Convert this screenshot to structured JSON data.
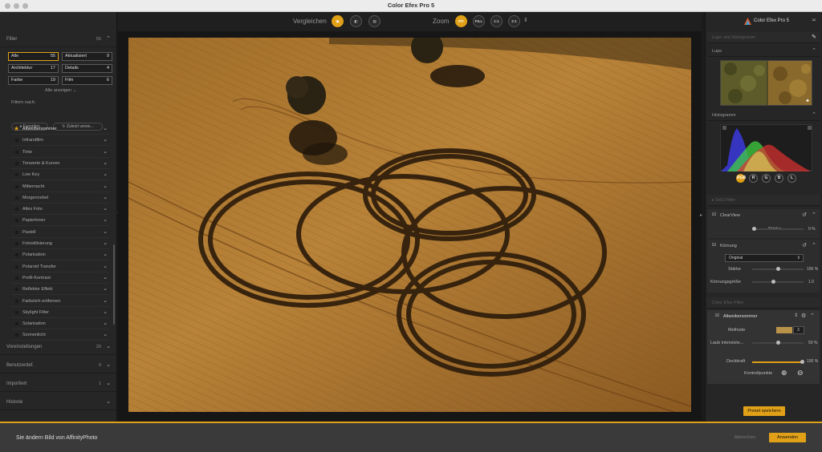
{
  "window": {
    "title": "Color Efex Pro 5"
  },
  "left": {
    "filter_header": {
      "label": "Filter",
      "count": "55"
    },
    "categories": [
      {
        "label": "Alle",
        "count": "55"
      },
      {
        "label": "Aktualisiert",
        "count": "9"
      },
      {
        "label": "Architektur",
        "count": "17"
      },
      {
        "label": "Details",
        "count": "4"
      },
      {
        "label": "Farbe",
        "count": "19"
      },
      {
        "label": "Film",
        "count": "6"
      }
    ],
    "show_all": "Alle anzeigen",
    "filter_by": "Filtern nach:",
    "favorites": "Favoriten",
    "recent": "Zuletzt verwe...",
    "filters": [
      "Altweibersommer",
      "Infrarotfilm",
      "Tinte",
      "Tonwerte & Kurven",
      "Low Key",
      "Mitternacht",
      "Morgennebel",
      "Altes Foto",
      "Papiertoner",
      "Pastell",
      "Fotostilisierung",
      "Polarisation",
      "Polaroid Transfer",
      "Profil-Kontrast",
      "Reflektor Effekt",
      "Farbstich entfernen",
      "Skylight Filter",
      "Solarisation",
      "Sonnenlicht"
    ],
    "sections": [
      {
        "label": "Voreinstellungen",
        "count": "20"
      },
      {
        "label": "Benutzerdef.",
        "count": "0"
      },
      {
        "label": "Importiert",
        "count": "1"
      },
      {
        "label": "Historie",
        "count": ""
      }
    ]
  },
  "toolbar": {
    "compare_label": "Vergleichen",
    "zoom_label": "Zoom",
    "zoom_options": [
      "FIT",
      "FILL",
      "1:1",
      "2:1"
    ]
  },
  "right": {
    "brand": "Color Efex Pro 5",
    "loupe_histogram_header": "Lupe und Histogramm",
    "loupe_header": "Lupe",
    "histogram_header": "Histogramm",
    "channels": [
      "RGB",
      "R",
      "G",
      "B",
      "L"
    ],
    "dxo_filter": "DxO Filter",
    "clearview": {
      "label": "ClearView",
      "strength_label": "Stärke",
      "strength_value": "0 %"
    },
    "grain": {
      "label": "Körnung",
      "preset": "Original",
      "strength_label": "Stärke",
      "strength_value": "100 %",
      "size_label": "Körnungsgröße",
      "size_value": "1.0"
    },
    "efex_filter": "Color Efex Filter",
    "indian_summer": {
      "label": "Altweibersommer",
      "method_label": "Methode",
      "method_value": "3",
      "foliage_label": "Laub intensivie...",
      "foliage_value": "50 %",
      "opacity_label": "Deckkraft",
      "opacity_value": "100 %",
      "control_points_label": "Kontrollpunkte"
    },
    "save_preset": "Preset speichern"
  },
  "bottom": {
    "message": "Sie ändern Bild von AffinityPhoto",
    "cancel": "Abbrechen",
    "apply": "Anwenden"
  },
  "colors": {
    "accent": "#e0a017"
  }
}
